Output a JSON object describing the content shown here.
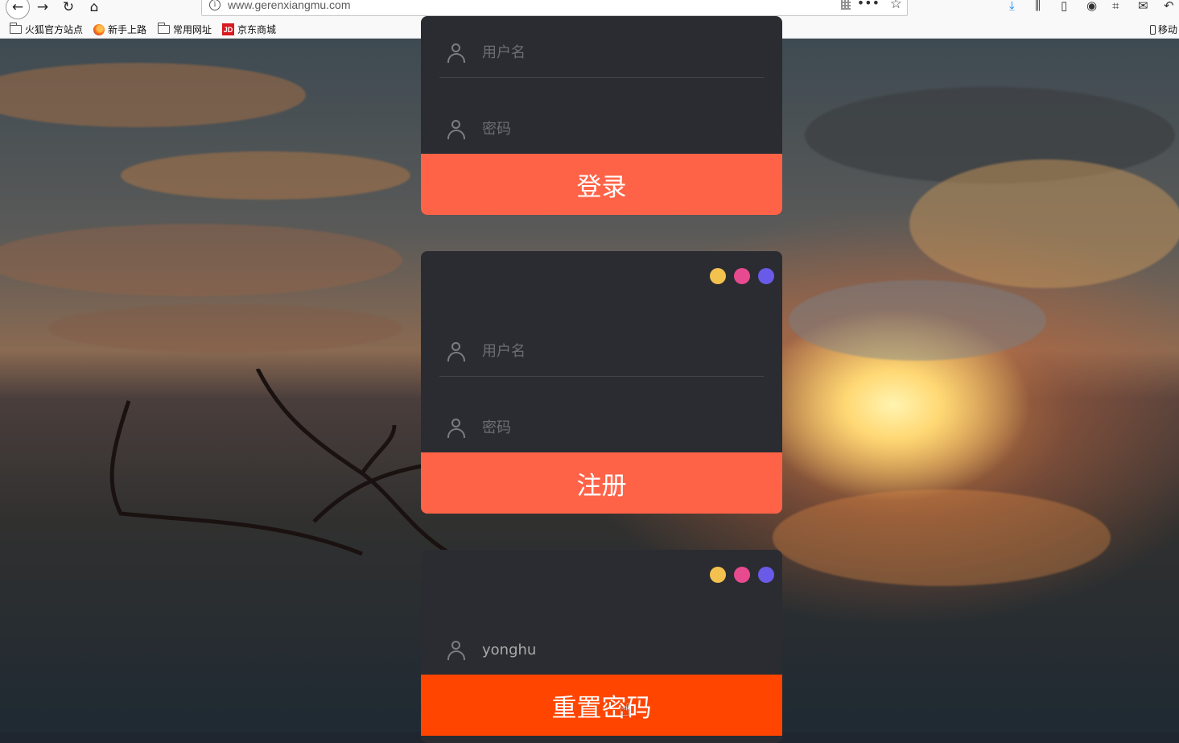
{
  "browser": {
    "url": "www.gerenxiangmu.com",
    "info_glyph": "i",
    "bookmarks": [
      {
        "label": "火狐官方站点",
        "icon": "folder-icon"
      },
      {
        "label": "新手上路",
        "icon": "firefox-icon"
      },
      {
        "label": "常用网址",
        "icon": "folder-icon"
      },
      {
        "label": "京东商城",
        "icon": "jd-icon"
      }
    ],
    "jd_logo_text": "JD",
    "mobile_label": "移动"
  },
  "colors": {
    "card_bg": "#2a2c31",
    "button": "#ff6347",
    "button_active": "#ff4500",
    "dot_yellow": "#f2c14e",
    "dot_pink": "#e84a8f",
    "dot_purple": "#6a5ae8"
  },
  "login_form": {
    "username_placeholder": "用户名",
    "password_placeholder": "密码",
    "submit_label": "登录"
  },
  "register_form": {
    "username_placeholder": "用户名",
    "password_placeholder": "密码",
    "submit_label": "注册"
  },
  "reset_form": {
    "username_value": "yonghu",
    "submit_label": "重置密码"
  }
}
